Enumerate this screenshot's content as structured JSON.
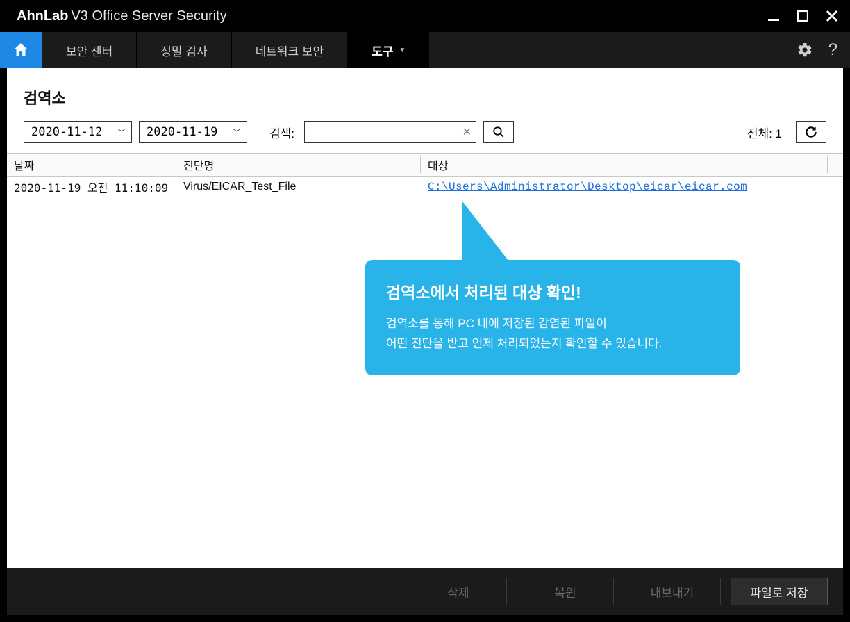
{
  "window": {
    "brand": "AhnLab",
    "product": "V3 Office Server Security"
  },
  "nav": {
    "tabs": [
      {
        "label": "보안 센터"
      },
      {
        "label": "정밀 검사"
      },
      {
        "label": "네트워크 보안"
      },
      {
        "label": "도구",
        "active": true,
        "dropdown": true
      }
    ]
  },
  "page": {
    "title": "검역소",
    "date_from": "2020-11-12",
    "date_to": "2020-11-19",
    "search_label": "검색:",
    "search_value": "",
    "total_label": "전체: 1"
  },
  "columns": {
    "date": "날짜",
    "diagnosis": "진단명",
    "target": "대상"
  },
  "rows": [
    {
      "date": "2020-11-19 오전 11:10:09",
      "diagnosis": "Virus/EICAR_Test_File",
      "target": "C:\\Users\\Administrator\\Desktop\\eicar\\eicar.com"
    }
  ],
  "callout": {
    "headline": "검역소에서 처리된 대상 확인!",
    "line1": "검역소를 통해 PC 내에 저장된 감염된 파일이",
    "line2": "어떤 진단을 받고 언제 처리되었는지 확인할 수 있습니다."
  },
  "footer": {
    "delete": "삭제",
    "restore": "복원",
    "export": "내보내기",
    "save": "파일로 저장"
  }
}
